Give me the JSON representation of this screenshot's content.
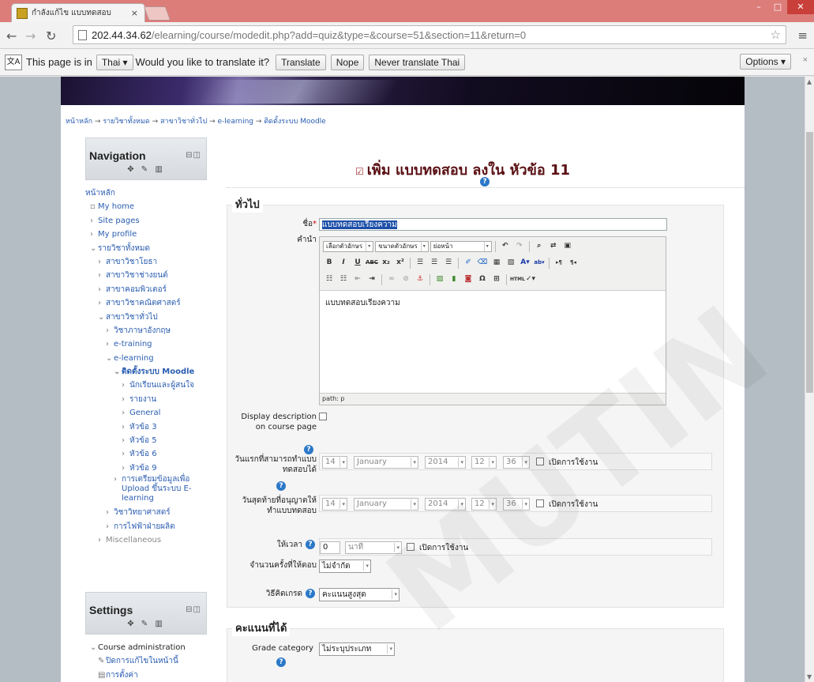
{
  "browser": {
    "tab_title": "กำลังแก้ไข แบบทดสอบ",
    "tab_close": "×",
    "url_host": "202.44.34.62",
    "url_path": "/elearning/course/modedit.php?add=quiz&type=&course=51&section=11&return=0",
    "translate_bar": {
      "prefix": "This page is in",
      "language": "Thai",
      "question": "Would you like to translate it?",
      "translate_label": "Translate",
      "nope_label": "Nope",
      "never_label": "Never translate Thai",
      "options_label": "Options"
    }
  },
  "breadcrumb": [
    "หน้าหลัก",
    "รายวิชาทั้งหมด",
    "สาขาวิชาทั่วไป",
    "e-learning",
    "ติดตั้งระบบ Moodle"
  ],
  "navigation": {
    "title": "Navigation",
    "home": "หน้าหลัก",
    "my_home": "My home",
    "site_pages": "Site pages",
    "my_profile": "My profile",
    "courses": "รายวิชาทั้งหมด",
    "cat1": "สาขาวิชาโยธา",
    "cat2": "สาขาวิชาช่างยนต์",
    "cat3": "สาขาคอมพิวเตอร์",
    "cat4": "สาขาวิชาคณิตศาสตร์",
    "cat5": "สาขาวิชาทั่วไป",
    "sub1": "วิชาภาษาอังกฤษ",
    "sub2": "e-training",
    "sub3": "e-learning",
    "course": "ติดตั้งระบบ Moodle",
    "c1": "นักเรียนและผู้สนใจ",
    "c2": "รายงาน",
    "c3": "General",
    "c4": "หัวข้อ 3",
    "c5": "หัวข้อ 5",
    "c6": "หัวข้อ 6",
    "c7": "หัวข้อ 9",
    "course2": "การเตรียมข้อมูลเพื่อ Upload ขึ้นระบบ E-learning",
    "sub4": "วิชาวิทยาศาสตร์",
    "sub5": "การไฟฟ้าฝ่ายผลิต",
    "misc": "Miscellaneous"
  },
  "settings": {
    "title": "Settings",
    "course_admin": "Course administration",
    "turn_off": "ปิดการแก้ไขในหน้านี้",
    "edit_settings": "การตั้งค่า"
  },
  "main": {
    "title": "เพิ่ม แบบทดสอบ ลงใน หัวข้อ 11",
    "help": "?",
    "general": {
      "legend": "ทั่วไป",
      "name_label": "ชื่อ",
      "name_req": "*",
      "name_value": "แบบทดสอบเรียงความ",
      "intro_label": "คำนำ",
      "font_family": "เลือกตัวอักษร",
      "font_size": "ขนาดตัวอักษร",
      "paragraph": "ย่อหน้า",
      "editor_text": "แบบทดสอบเรียงความ",
      "path": "path: p",
      "display_desc_label": "Display description on course page",
      "open_label": "วันแรกที่สามารถทำแบบทดสอบได้",
      "close_label": "วันสุดท้ายที่อนุญาตให้ทำแบบทดสอบ",
      "day": "14",
      "month": "January",
      "year": "2014",
      "hour": "12",
      "minute": "36",
      "enable": "เปิดการใช้งาน",
      "timelimit_label": "ให้เวลา",
      "timelimit_value": "0",
      "timelimit_unit": "นาที",
      "attempts_label": "จำนวนครั้งที่ให้ตอบ",
      "attempts_value": "ไม่จำกัด",
      "grademethod_label": "วิธีคิดเกรด",
      "grademethod_value": "คะแนนสูงสุด"
    },
    "grade": {
      "legend": "คะแนนที่ได้",
      "category_label": "Grade category",
      "category_value": "ไม่ระบุประเภท"
    }
  },
  "watermark": "MUTIN"
}
